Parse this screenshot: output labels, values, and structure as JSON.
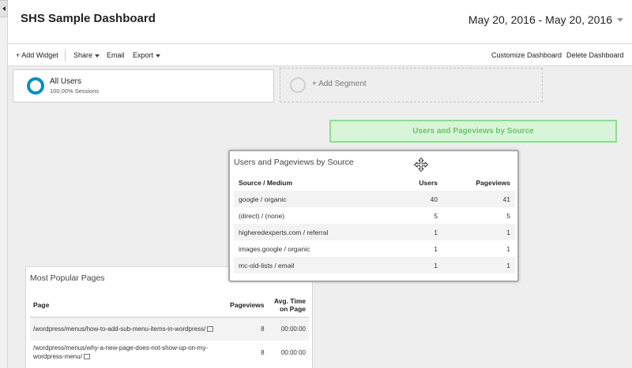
{
  "header": {
    "title": "SHS Sample Dashboard",
    "date_range": "May 20, 2016 - May 20, 2016"
  },
  "toolbar": {
    "add_widget": "+ Add Widget",
    "share": "Share",
    "email": "Email",
    "export": "Export",
    "customize": "Customize Dashboard",
    "delete": "Delete Dashboard"
  },
  "segments": {
    "active": {
      "title": "All Users",
      "subtitle": "100.00% Sessions",
      "color": "#058dc7"
    },
    "add_label": "+ Add Segment"
  },
  "drop_target": {
    "label": "Users and Pageviews by Source",
    "color": "#8fdc8f"
  },
  "widget_source": {
    "title": "Users and Pageviews by Source",
    "columns": [
      "Source / Medium",
      "Users",
      "Pageviews"
    ],
    "rows": [
      [
        "google / organic",
        "40",
        "41"
      ],
      [
        "(direct) / (none)",
        "5",
        "5"
      ],
      [
        "higheredexperts.com / referral",
        "1",
        "1"
      ],
      [
        "images.google / organic",
        "1",
        "1"
      ],
      [
        "mc-old-lists / email",
        "1",
        "1"
      ]
    ]
  },
  "widget_popular": {
    "title": "Most Popular Pages",
    "columns": [
      "Page",
      "Pageviews",
      "Avg. Time on Page"
    ],
    "rows": [
      [
        "/wordpress/menus/how-to-add-sub-menu-items-in-wordpress/",
        "8",
        "00:00:00"
      ],
      [
        "/wordpress/menus/why-a-new-page-does-not-show-up-on-my-wordpress-menu/",
        "8",
        "00:00:00"
      ]
    ]
  },
  "icons": {
    "collapse": "collapse-left-icon",
    "segment": "segment-ring-icon",
    "move": "move-cursor-icon",
    "external": "external-link-icon"
  }
}
